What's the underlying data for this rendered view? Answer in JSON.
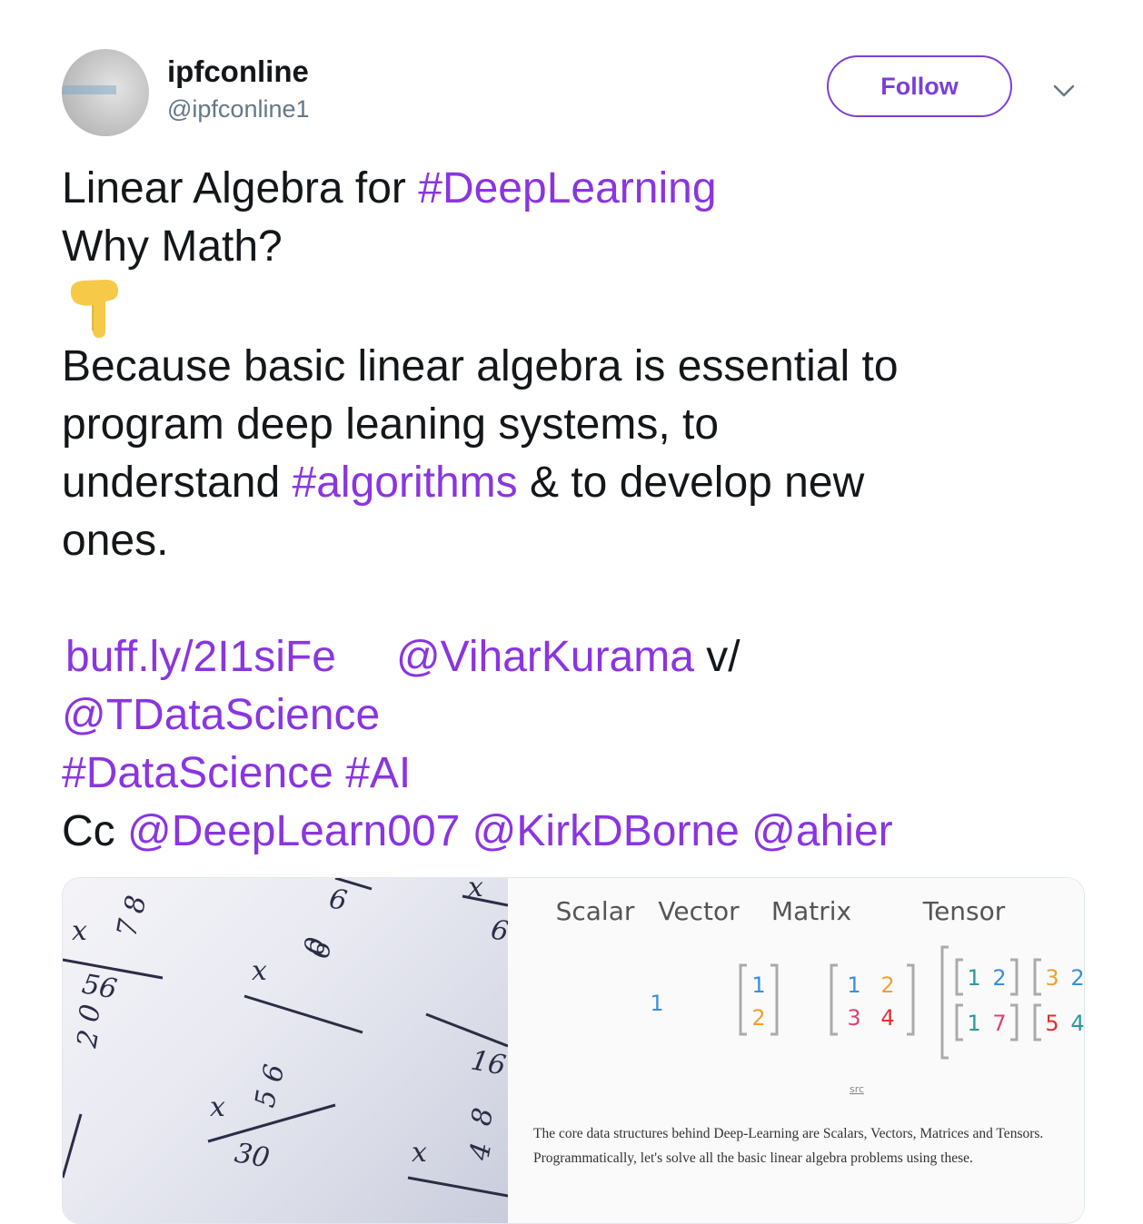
{
  "header": {
    "display_name": "ipfconline",
    "handle": "@ipfconline1",
    "follow_label": "Follow",
    "avatar_icon": "ipfconline-avatar",
    "menu_icon": "chevron-down-icon"
  },
  "tweet": {
    "line1_text": "Linear Algebra for ",
    "line1_hashtag": "#DeepLearning",
    "line2": "Why Math?",
    "emoji": "backhand-index-pointing-down-icon",
    "line3": "Because basic linear algebra is essential to",
    "line4": "program deep leaning systems, to",
    "line5_a": "understand ",
    "line5_hashtag": "#algorithms",
    "line5_b": " & to develop new",
    "line6": "ones.",
    "link_url": "buff.ly/2I1siFe",
    "mention_author": "@ViharKurama",
    "via_text": " v/",
    "mention_pub": "@TDataScience",
    "hashtag_ds": "#DataScience",
    "hashtag_ai": "#AI",
    "cc_text": "Cc ",
    "mention_1": "@DeepLearn007",
    "mention_2": "@KirkDBorne",
    "mention_3": "@ahier"
  },
  "media": {
    "photo_digits": [
      "8",
      "7",
      "x",
      "56",
      "0",
      "2",
      "6",
      "0",
      "x",
      "6",
      "5",
      "x",
      "30",
      "x",
      "6",
      "x",
      "8",
      "4",
      "x",
      "6",
      "16"
    ],
    "diagram": {
      "headers": [
        "Scalar",
        "Vector",
        "Matrix",
        "Tensor"
      ],
      "scalar": "1",
      "vector": [
        "1",
        "2"
      ],
      "matrix": [
        "1",
        "2",
        "3",
        "4"
      ],
      "tensor": [
        "1",
        "2",
        "3",
        "2",
        "1",
        "7",
        "5",
        "4"
      ],
      "src": "src",
      "caption": "The core data structures behind Deep-Learning are Scalars, Vectors, Matrices and Tensors. Programmatically, let's solve all the basic linear algebra problems using these."
    }
  },
  "colors": {
    "accent": "#8a35e0",
    "text": "#14171a",
    "muted": "#657786"
  }
}
